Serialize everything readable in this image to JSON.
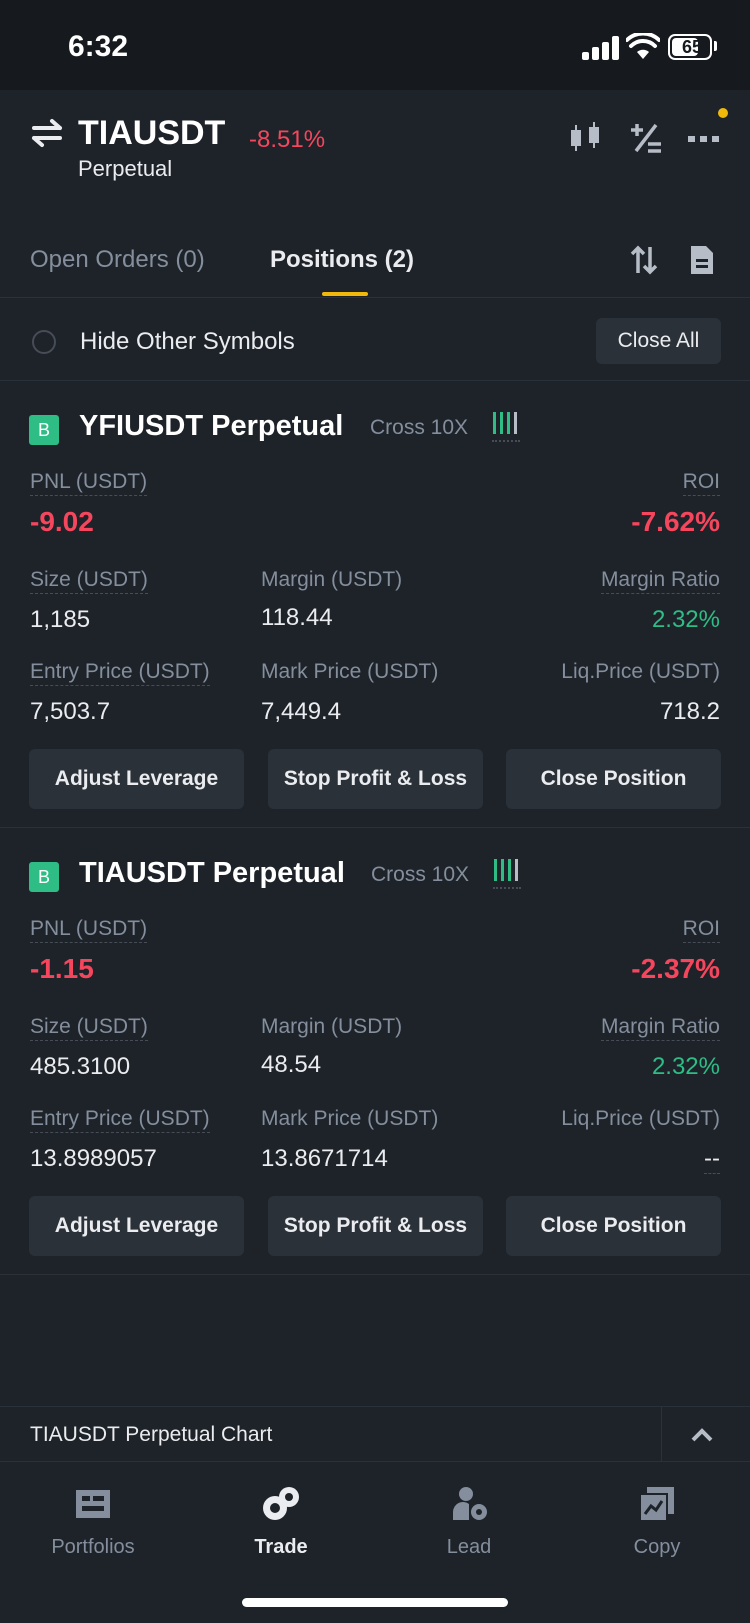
{
  "status": {
    "time": "6:32",
    "battery": "65"
  },
  "header": {
    "symbol": "TIAUSDT",
    "change": "-8.51%",
    "subtitle": "Perpetual"
  },
  "tabs": {
    "open_orders": "Open Orders (0)",
    "positions": "Positions (2)"
  },
  "filter": {
    "hide_label": "Hide Other Symbols",
    "close_all": "Close All"
  },
  "labels": {
    "pnl": "PNL (USDT)",
    "roi": "ROI",
    "size": "Size (USDT)",
    "margin": "Margin (USDT)",
    "margin_ratio": "Margin Ratio",
    "entry": "Entry Price (USDT)",
    "mark": "Mark Price (USDT)",
    "liq": "Liq.Price (USDT)",
    "adjust": "Adjust Leverage",
    "stop": "Stop Profit & Loss",
    "close": "Close Position"
  },
  "positions": [
    {
      "badge": "B",
      "title": "YFIUSDT Perpetual",
      "mode": "Cross 10X",
      "pnl": "-9.02",
      "roi": "-7.62%",
      "size": "1,185",
      "margin": "118.44",
      "margin_ratio": "2.32%",
      "entry": "7,503.7",
      "mark": "7,449.4",
      "liq": "718.2"
    },
    {
      "badge": "B",
      "title": "TIAUSDT Perpetual",
      "mode": "Cross 10X",
      "pnl": "-1.15",
      "roi": "-2.37%",
      "size": "485.3100",
      "margin": "48.54",
      "margin_ratio": "2.32%",
      "entry": "13.8989057",
      "mark": "13.8671714",
      "liq": "--"
    }
  ],
  "chart_bar": {
    "label": "TIAUSDT Perpetual  Chart"
  },
  "nav": [
    {
      "label": "Portfolios",
      "icon": "portfolio-icon"
    },
    {
      "label": "Trade",
      "icon": "trade-icon"
    },
    {
      "label": "Lead",
      "icon": "lead-icon"
    },
    {
      "label": "Copy",
      "icon": "copy-icon"
    }
  ],
  "colors": {
    "negative": "#f6465d",
    "positive": "#2ebd85",
    "accent": "#f0b90b",
    "bg": "#1e2329"
  }
}
